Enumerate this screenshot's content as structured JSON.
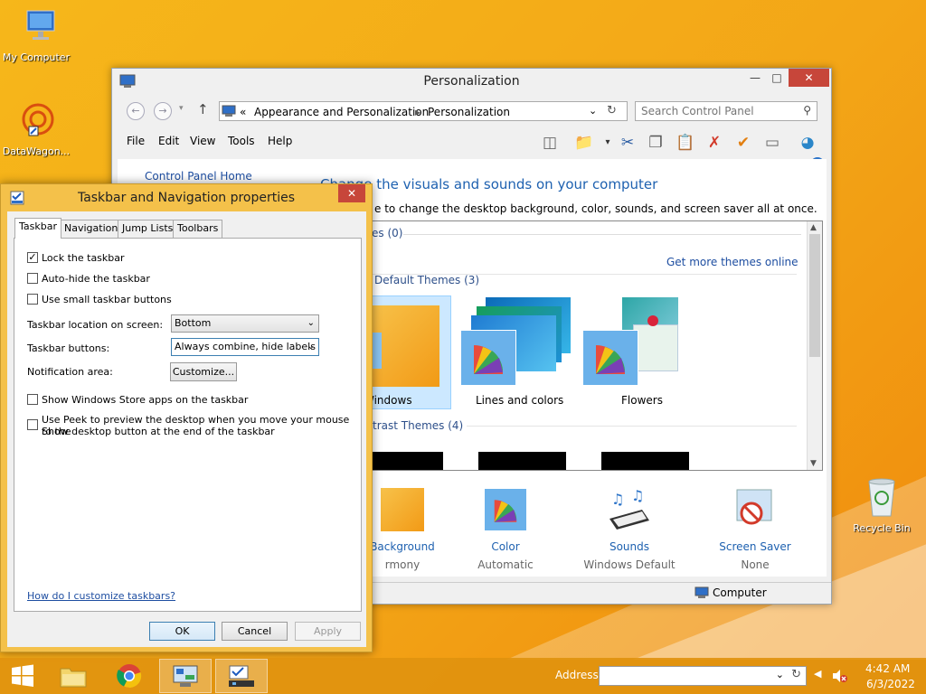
{
  "desktop": {
    "icons": [
      {
        "label": "My Computer"
      },
      {
        "label": "DataWagon..."
      },
      {
        "label": "Recycle Bin"
      }
    ]
  },
  "personalization": {
    "title": "Personalization",
    "breadcrumb": [
      "«",
      "Appearance and Personalization",
      "Personalization"
    ],
    "search_placeholder": "Search Control Panel",
    "menu": [
      "File",
      "Edit",
      "View",
      "Tools",
      "Help"
    ],
    "left_link": "Control Panel Home",
    "heading": "Change the visuals and sounds on your computer",
    "subheading": "e to change the desktop background, color, sounds, and screen saver all at once.",
    "get_more": "Get more themes online",
    "groups": {
      "my": "es (0)",
      "default": "Default Themes (3)",
      "contrast": "trast Themes (4)"
    },
    "themes": [
      {
        "label": "Windows"
      },
      {
        "label": "Lines and colors"
      },
      {
        "label": "Flowers"
      }
    ],
    "bottom": [
      {
        "label": "Background",
        "sub": "rmony"
      },
      {
        "label": "Color",
        "sub": "Automatic"
      },
      {
        "label": "Sounds",
        "sub": "Windows Default"
      },
      {
        "label": "Screen Saver",
        "sub": "None"
      }
    ],
    "status": "Computer"
  },
  "dialog": {
    "title": "Taskbar and Navigation properties",
    "tabs": [
      "Taskbar",
      "Navigation",
      "Jump Lists",
      "Toolbars"
    ],
    "options": {
      "lock": "Lock the taskbar",
      "autohide": "Auto-hide the taskbar",
      "small": "Use small taskbar buttons",
      "store": "Show Windows Store apps on the taskbar",
      "peek1": "Use Peek to preview the desktop when you move your mouse to the",
      "peek2": "Show desktop button at the end of the taskbar"
    },
    "location_label": "Taskbar location on screen:",
    "location_value": "Bottom",
    "buttons_label": "Taskbar buttons:",
    "buttons_value": "Always combine, hide labels",
    "notif_label": "Notification area:",
    "customize": "Customize...",
    "help_link": "How do I customize taskbars?",
    "ok": "OK",
    "cancel": "Cancel",
    "apply": "Apply"
  },
  "taskbar": {
    "address_label": "Address",
    "time": "4:42 AM",
    "date": "6/3/2022"
  }
}
